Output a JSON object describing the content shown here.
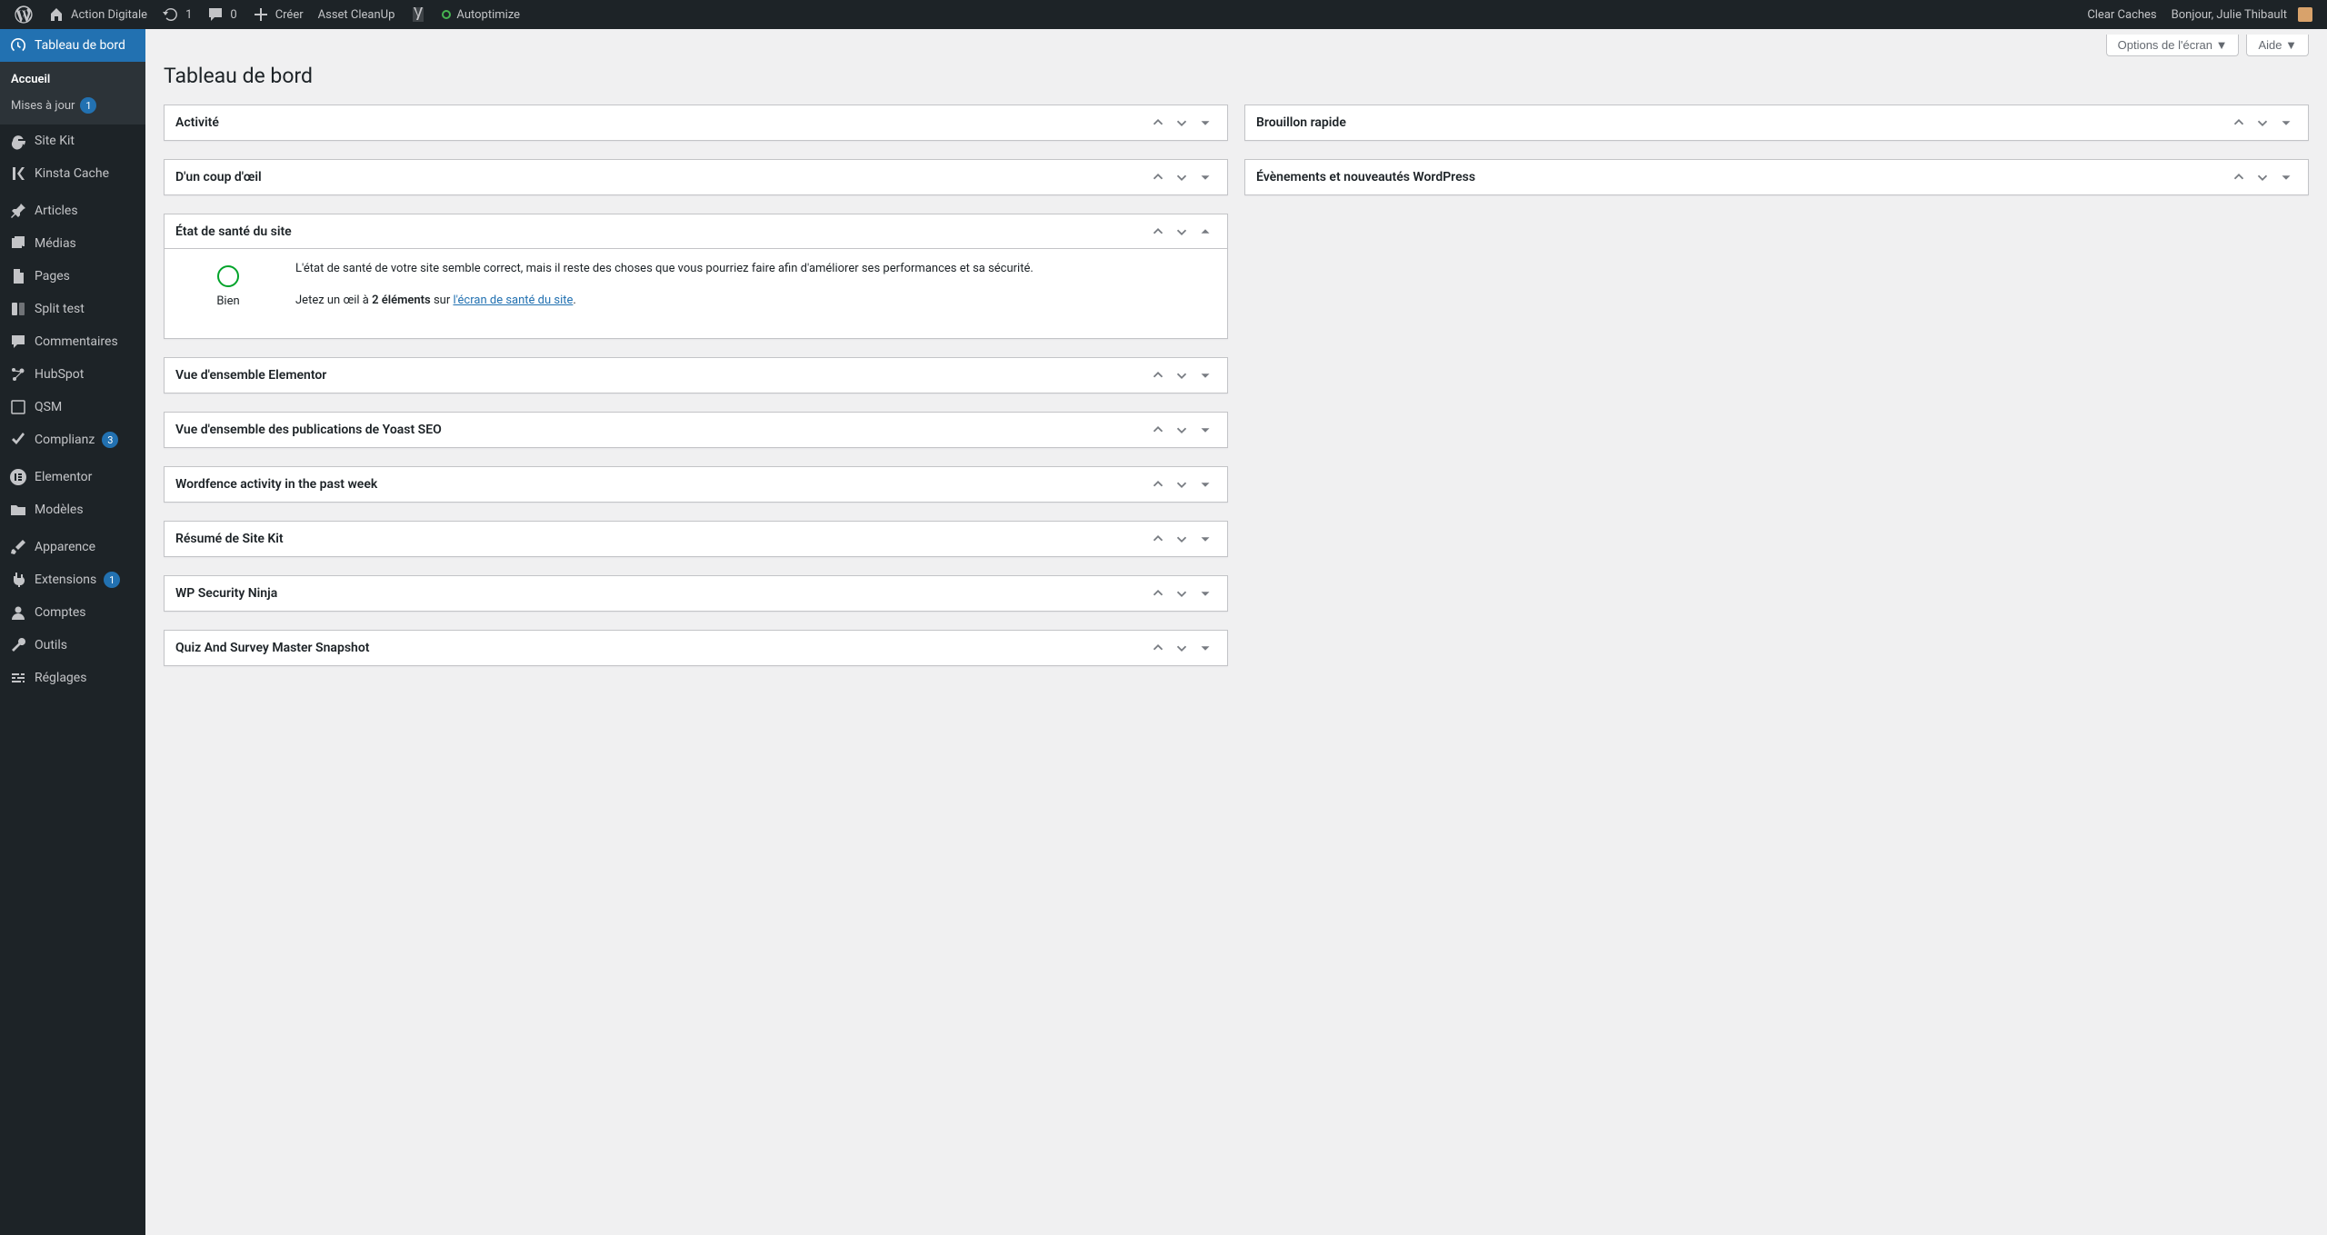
{
  "adminBar": {
    "siteName": "Action Digitale",
    "updates": "1",
    "comments": "0",
    "create": "Créer",
    "assetCleanup": "Asset CleanUp",
    "autoptimize": "Autoptimize",
    "clearCaches": "Clear Caches",
    "greeting": "Bonjour, Julie Thibault"
  },
  "sidebar": {
    "dashboard": "Tableau de bord",
    "home": "Accueil",
    "updates": "Mises à jour",
    "updatesBadge": "1",
    "siteKit": "Site Kit",
    "kinsta": "Kinsta Cache",
    "posts": "Articles",
    "media": "Médias",
    "pages": "Pages",
    "split": "Split test",
    "commentsItem": "Commentaires",
    "hubspot": "HubSpot",
    "qsm": "QSM",
    "complianz": "Complianz",
    "complianzBadge": "3",
    "elementor": "Elementor",
    "templates": "Modèles",
    "appearance": "Apparence",
    "plugins": "Extensions",
    "pluginsBadge": "1",
    "users": "Comptes",
    "tools": "Outils",
    "settings": "Réglages"
  },
  "screen": {
    "options": "Options de l'écran",
    "help": "Aide"
  },
  "pageTitle": "Tableau de bord",
  "postboxes": {
    "activity": "Activité",
    "glance": "D'un coup d'œil",
    "health": "État de santé du site",
    "elementor": "Vue d'ensemble Elementor",
    "yoast": "Vue d'ensemble des publications de Yoast SEO",
    "wordfence": "Wordfence activity in the past week",
    "sitekit": "Résumé de Site Kit",
    "ninja": "WP Security Ninja",
    "quiz": "Quiz And Survey Master Snapshot",
    "draft": "Brouillon rapide",
    "events": "Évènements et nouveautés WordPress"
  },
  "health": {
    "status": "Bien",
    "desc": "L'état de santé de votre site semble correct, mais il reste des choses que vous pourriez faire afin d'améliorer ses performances et sa sécurité.",
    "look1": "Jetez un œil à ",
    "count": "2 éléments",
    "look2": " sur ",
    "link": "l'écran de santé du site",
    "period": "."
  }
}
